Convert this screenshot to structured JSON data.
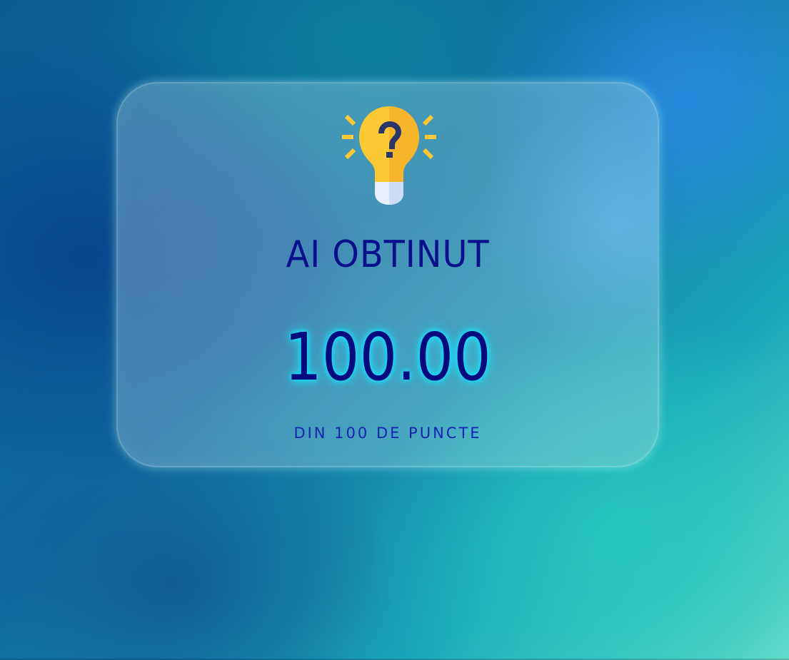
{
  "result_card": {
    "icon": "lightbulb-question-icon",
    "title": "AI OBTINUT",
    "score": "100.00",
    "subtitle": "DIN 100 DE PUNCTE"
  },
  "colors": {
    "title_text": "#0a0f8c",
    "score_text": "#050a7e",
    "score_glow": "#19e3ff",
    "subtitle_text": "#1424b0",
    "bulb_yellow": "#fcc934",
    "bulb_shade": "#f6b52a",
    "question_mark": "#2a3568"
  }
}
